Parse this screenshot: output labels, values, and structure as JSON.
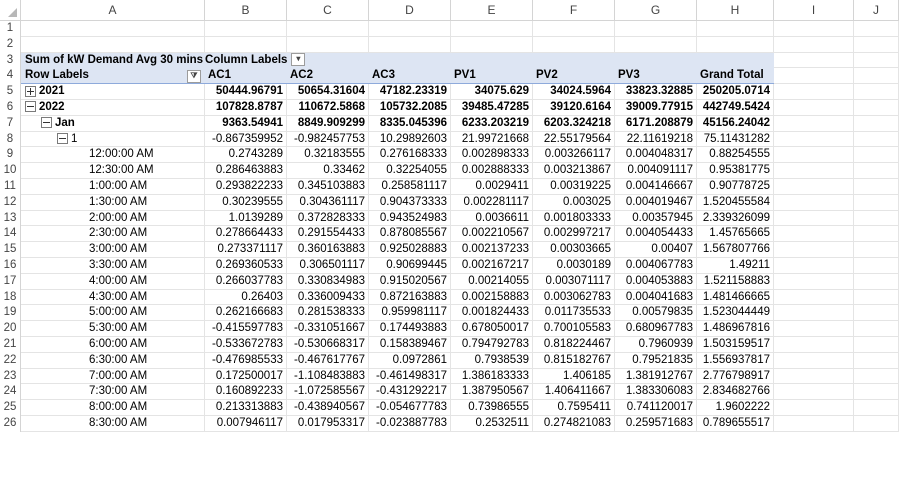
{
  "column_letters": [
    "A",
    "B",
    "C",
    "D",
    "E",
    "F",
    "G",
    "H",
    "I",
    "J"
  ],
  "pivot": {
    "title": "Sum of kW Demand Avg 30 mins",
    "column_labels_caption": "Column Labels",
    "row_labels_caption": "Row Labels",
    "columns": [
      "AC1",
      "AC2",
      "AC3",
      "PV1",
      "PV2",
      "PV3",
      "Grand Total"
    ],
    "filter_icon": "filter-dropdown-icon",
    "rows": [
      {
        "n": "5",
        "label": "2021",
        "expander": "plus",
        "indent": 0,
        "bold": true,
        "values": [
          "50444.96791",
          "50654.31604",
          "47182.23319",
          "34075.629",
          "34024.5964",
          "33823.32885",
          "250205.0714"
        ]
      },
      {
        "n": "6",
        "label": "2022",
        "expander": "minus",
        "indent": 0,
        "bold": true,
        "values": [
          "107828.8787",
          "110672.5868",
          "105732.2085",
          "39485.47285",
          "39120.6164",
          "39009.77915",
          "442749.5424"
        ]
      },
      {
        "n": "7",
        "label": "Jan",
        "expander": "minus",
        "indent": 1,
        "bold": true,
        "values": [
          "9363.54941",
          "8849.909299",
          "8335.045396",
          "6233.203219",
          "6203.324218",
          "6171.208879",
          "45156.24042"
        ]
      },
      {
        "n": "8",
        "label": "1",
        "expander": "minus",
        "indent": 2,
        "bold": false,
        "values": [
          "-0.867359952",
          "-0.982457753",
          "10.29892603",
          "21.99721668",
          "22.55179564",
          "22.11619218",
          "75.11431282"
        ]
      },
      {
        "n": "9",
        "label": "12:00:00 AM",
        "indent": 3,
        "values": [
          "0.2743289",
          "0.32183555",
          "0.276168333",
          "0.002898333",
          "0.003266117",
          "0.004048317",
          "0.88254555"
        ]
      },
      {
        "n": "10",
        "label": "12:30:00 AM",
        "indent": 3,
        "values": [
          "0.286463883",
          "0.33462",
          "0.32254055",
          "0.002888333",
          "0.003213867",
          "0.004091117",
          "0.95381775"
        ]
      },
      {
        "n": "11",
        "label": "1:00:00 AM",
        "indent": 3,
        "values": [
          "0.293822233",
          "0.345103883",
          "0.258581117",
          "0.0029411",
          "0.00319225",
          "0.004146667",
          "0.90778725"
        ]
      },
      {
        "n": "12",
        "label": "1:30:00 AM",
        "indent": 3,
        "values": [
          "0.30239555",
          "0.304361117",
          "0.904373333",
          "0.002281117",
          "0.003025",
          "0.004019467",
          "1.520455584"
        ]
      },
      {
        "n": "13",
        "label": "2:00:00 AM",
        "indent": 3,
        "values": [
          "1.0139289",
          "0.372828333",
          "0.943524983",
          "0.0036611",
          "0.001803333",
          "0.00357945",
          "2.339326099"
        ]
      },
      {
        "n": "14",
        "label": "2:30:00 AM",
        "indent": 3,
        "values": [
          "0.278664433",
          "0.291554433",
          "0.878085567",
          "0.002210567",
          "0.002997217",
          "0.004054433",
          "1.45765665"
        ]
      },
      {
        "n": "15",
        "label": "3:00:00 AM",
        "indent": 3,
        "values": [
          "0.273371117",
          "0.360163883",
          "0.925028883",
          "0.002137233",
          "0.00303665",
          "0.00407",
          "1.567807766"
        ]
      },
      {
        "n": "16",
        "label": "3:30:00 AM",
        "indent": 3,
        "values": [
          "0.269360533",
          "0.306501117",
          "0.90699445",
          "0.002167217",
          "0.0030189",
          "0.004067783",
          "1.49211"
        ]
      },
      {
        "n": "17",
        "label": "4:00:00 AM",
        "indent": 3,
        "values": [
          "0.266037783",
          "0.330834983",
          "0.915020567",
          "0.00214055",
          "0.003071117",
          "0.004053883",
          "1.521158883"
        ]
      },
      {
        "n": "18",
        "label": "4:30:00 AM",
        "indent": 3,
        "values": [
          "0.26403",
          "0.336009433",
          "0.872163883",
          "0.002158883",
          "0.003062783",
          "0.004041683",
          "1.481466665"
        ]
      },
      {
        "n": "19",
        "label": "5:00:00 AM",
        "indent": 3,
        "values": [
          "0.262166683",
          "0.281538333",
          "0.959981117",
          "0.001824433",
          "0.011735533",
          "0.00579835",
          "1.523044449"
        ]
      },
      {
        "n": "20",
        "label": "5:30:00 AM",
        "indent": 3,
        "values": [
          "-0.415597783",
          "-0.331051667",
          "0.174493883",
          "0.678050017",
          "0.700105583",
          "0.680967783",
          "1.486967816"
        ]
      },
      {
        "n": "21",
        "label": "6:00:00 AM",
        "indent": 3,
        "values": [
          "-0.533672783",
          "-0.530668317",
          "0.158389467",
          "0.794792783",
          "0.818224467",
          "0.7960939",
          "1.503159517"
        ]
      },
      {
        "n": "22",
        "label": "6:30:00 AM",
        "indent": 3,
        "values": [
          "-0.476985533",
          "-0.467617767",
          "0.0972861",
          "0.7938539",
          "0.815182767",
          "0.79521835",
          "1.556937817"
        ]
      },
      {
        "n": "23",
        "label": "7:00:00 AM",
        "indent": 3,
        "values": [
          "0.172500017",
          "-1.108483883",
          "-0.461498317",
          "1.386183333",
          "1.406185",
          "1.381912767",
          "2.776798917"
        ]
      },
      {
        "n": "24",
        "label": "7:30:00 AM",
        "indent": 3,
        "values": [
          "0.160892233",
          "-1.072585567",
          "-0.431292217",
          "1.387950567",
          "1.406411667",
          "1.383306083",
          "2.834682766"
        ]
      },
      {
        "n": "25",
        "label": "8:00:00 AM",
        "indent": 3,
        "values": [
          "0.213313883",
          "-0.438940567",
          "-0.054677783",
          "0.73986555",
          "0.7595411",
          "0.741120017",
          "1.9602222"
        ]
      },
      {
        "n": "26",
        "label": "8:30:00 AM",
        "indent": 3,
        "values": [
          "0.007946117",
          "0.017953317",
          "-0.023887783",
          "0.2532511",
          "0.274821083",
          "0.259571683",
          "0.789655517"
        ]
      }
    ]
  },
  "empty_rows": [
    "1",
    "2"
  ],
  "header_rows": {
    "title_row": "3",
    "labels_row": "4"
  }
}
